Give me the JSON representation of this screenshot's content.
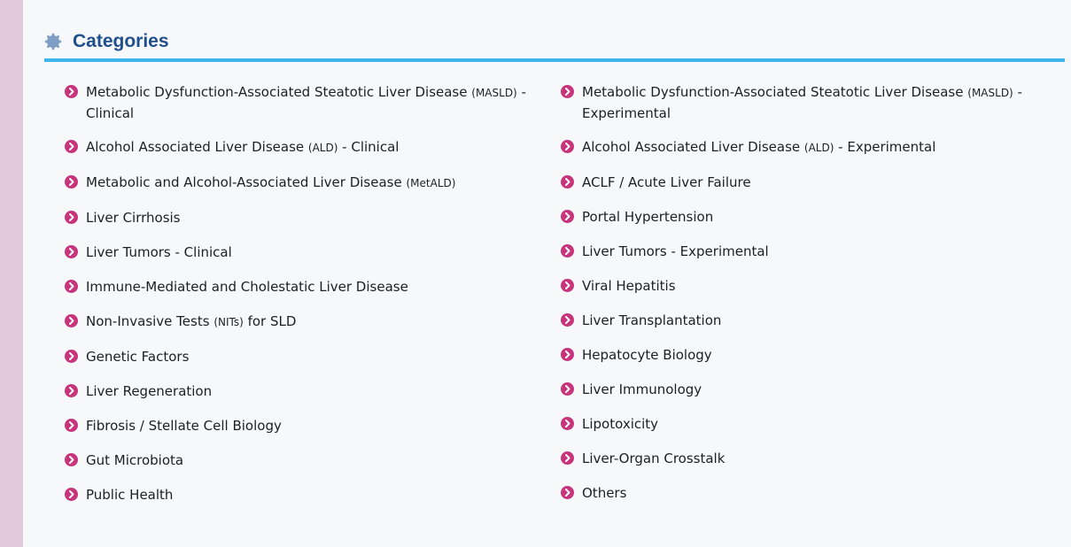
{
  "header": {
    "title": "Categories",
    "icon": "gear-icon",
    "accent_color": "#3db6ea",
    "title_color": "#1f4f8c",
    "bullet_color": "#c8347c"
  },
  "categories": {
    "left": [
      {
        "text": "Metabolic Dysfunction-Associated Steatotic Liver Disease",
        "abbr": "(MASLD)",
        "suffix": " - Clinical"
      },
      {
        "text": "Alcohol Associated Liver Disease",
        "abbr": "(ALD)",
        "suffix": " - Clinical"
      },
      {
        "text": "Metabolic and Alcohol-Associated Liver Disease",
        "abbr": "(MetALD)",
        "suffix": ""
      },
      {
        "text": "Liver Cirrhosis",
        "abbr": "",
        "suffix": ""
      },
      {
        "text": "Liver Tumors - Clinical",
        "abbr": "",
        "suffix": ""
      },
      {
        "text": "Immune-Mediated and Cholestatic Liver Disease",
        "abbr": "",
        "suffix": ""
      },
      {
        "text": "Non-Invasive Tests",
        "abbr": "(NITs)",
        "suffix": " for SLD"
      },
      {
        "text": "Genetic Factors",
        "abbr": "",
        "suffix": ""
      },
      {
        "text": "Liver Regeneration",
        "abbr": "",
        "suffix": ""
      },
      {
        "text": "Fibrosis / Stellate Cell Biology",
        "abbr": "",
        "suffix": ""
      },
      {
        "text": "Gut Microbiota",
        "abbr": "",
        "suffix": ""
      },
      {
        "text": "Public Health",
        "abbr": "",
        "suffix": ""
      }
    ],
    "right": [
      {
        "text": "Metabolic Dysfunction-Associated Steatotic Liver Disease",
        "abbr": "(MASLD)",
        "suffix": " - Experimental"
      },
      {
        "text": "Alcohol Associated Liver Disease",
        "abbr": "(ALD)",
        "suffix": " - Experimental"
      },
      {
        "text": "ACLF / Acute Liver Failure",
        "abbr": "",
        "suffix": ""
      },
      {
        "text": "Portal Hypertension",
        "abbr": "",
        "suffix": ""
      },
      {
        "text": "Liver Tumors - Experimental",
        "abbr": "",
        "suffix": ""
      },
      {
        "text": "Viral Hepatitis",
        "abbr": "",
        "suffix": ""
      },
      {
        "text": "Liver Transplantation",
        "abbr": "",
        "suffix": ""
      },
      {
        "text": "Hepatocyte Biology",
        "abbr": "",
        "suffix": ""
      },
      {
        "text": "Liver Immunology",
        "abbr": "",
        "suffix": ""
      },
      {
        "text": "Lipotoxicity",
        "abbr": "",
        "suffix": ""
      },
      {
        "text": "Liver-Organ Crosstalk",
        "abbr": "",
        "suffix": ""
      },
      {
        "text": "Others",
        "abbr": "",
        "suffix": ""
      }
    ]
  }
}
